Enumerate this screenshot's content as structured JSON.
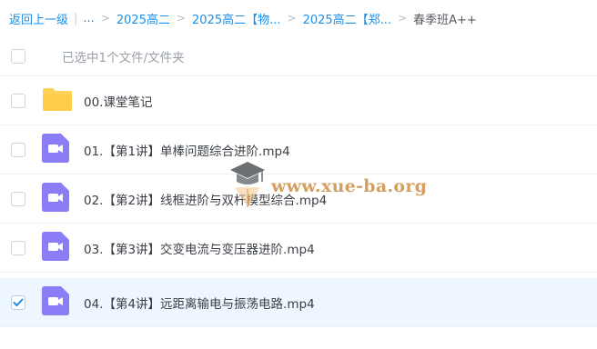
{
  "breadcrumb": {
    "back_label": "返回上一级",
    "ellipsis": "...",
    "crumbs": [
      "2025高二",
      "2025高二【物...",
      "2025高二【郑..."
    ],
    "current": "春季班A++"
  },
  "selection": {
    "summary": "已选中1个文件/文件夹"
  },
  "files": [
    {
      "name": "00.课堂笔记",
      "type": "folder-icon",
      "checked": false
    },
    {
      "name": "01.【第1讲】单棒问题综合进阶.mp4",
      "type": "video-icon",
      "checked": false
    },
    {
      "name": "02.【第2讲】线框进阶与双杆模型综合.mp4",
      "type": "video-icon",
      "checked": false
    },
    {
      "name": "03.【第3讲】交变电流与变压器进阶.mp4",
      "type": "video-icon",
      "checked": false
    },
    {
      "name": "04.【第4讲】远距离输电与振荡电路.mp4",
      "type": "video-icon",
      "checked": true
    }
  ],
  "watermark": {
    "text": "www.xue-ba.org"
  },
  "colors": {
    "link": "#1a8ee8",
    "folder": "#ffd257",
    "video": "#8a7df5",
    "selected_row": "#eef7ff",
    "check": "#1a8ee8",
    "watermark": "#d4a062"
  }
}
